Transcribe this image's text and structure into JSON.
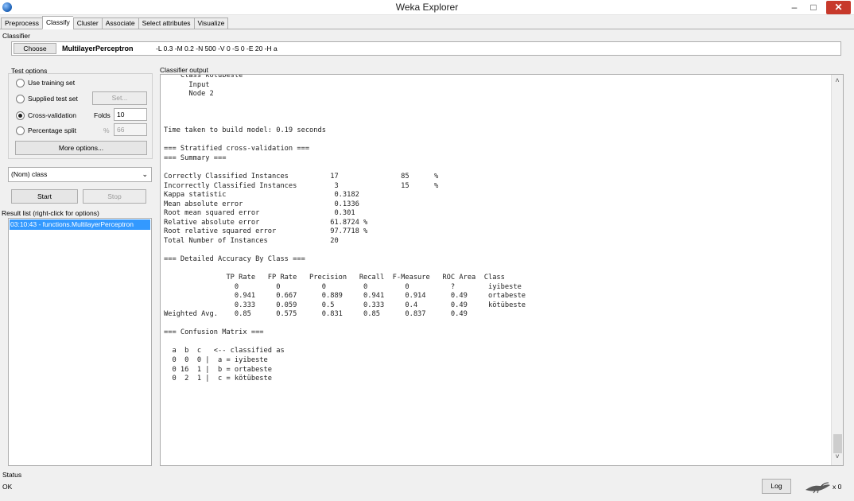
{
  "window": {
    "title": "Weka Explorer",
    "minimize": "–",
    "maximize": "□",
    "close": "✕",
    "icon": "weka-app-icon"
  },
  "tabs": [
    "Preprocess",
    "Classify",
    "Cluster",
    "Associate",
    "Select attributes",
    "Visualize"
  ],
  "active_tab": "Classify",
  "classifier": {
    "section_label": "Classifier",
    "choose_label": "Choose",
    "name": "MultilayerPerceptron",
    "options": "-L 0.3 -M 0.2 -N 500 -V 0 -S 0 -E 20 -H a"
  },
  "test_options": {
    "label": "Test options",
    "use_training_set": "Use training set",
    "supplied_test_set": "Supplied test set",
    "set_button": "Set...",
    "cross_validation": "Cross-validation",
    "folds_label": "Folds",
    "folds_value": "10",
    "percentage_split": "Percentage split",
    "percent_symbol": "%",
    "percent_value": "66",
    "more_options": "More options...",
    "selected": "Cross-validation"
  },
  "class_select": {
    "value": "(Nom) class"
  },
  "actions": {
    "start": "Start",
    "stop": "Stop"
  },
  "result_list": {
    "label": "Result list (right-click for options)",
    "items": [
      "03:10:43 - functions.MultilayerPerceptron"
    ]
  },
  "output": {
    "label": "Classifier output",
    "text": "    Class kötübeste\n      Input\n      Node 2\n\n\n\nTime taken to build model: 0.19 seconds\n\n=== Stratified cross-validation ===\n=== Summary ===\n\nCorrectly Classified Instances          17               85      %\nIncorrectly Classified Instances         3               15      %\nKappa statistic                          0.3182\nMean absolute error                      0.1336\nRoot mean squared error                  0.301 \nRelative absolute error                 61.8724 %\nRoot relative squared error             97.7718 %\nTotal Number of Instances               20     \n\n=== Detailed Accuracy By Class ===\n\n               TP Rate   FP Rate   Precision   Recall  F-Measure   ROC Area  Class\n                 0         0          0         0         0          ?        iyibeste\n                 0.941     0.667      0.889     0.941     0.914      0.49     ortabeste\n                 0.333     0.059      0.5       0.333     0.4        0.49     kötübeste\nWeighted Avg.    0.85      0.575      0.831     0.85      0.837      0.49 \n\n=== Confusion Matrix ===\n\n  a  b  c   <-- classified as\n  0  0  0 |  a = iyibeste\n  0 16  1 |  b = ortabeste\n  0  2  1 |  c = kötübeste"
  },
  "status": {
    "label": "Status",
    "text": "OK",
    "log_button": "Log",
    "counter": "x 0",
    "icon": "weka-bird-icon"
  }
}
